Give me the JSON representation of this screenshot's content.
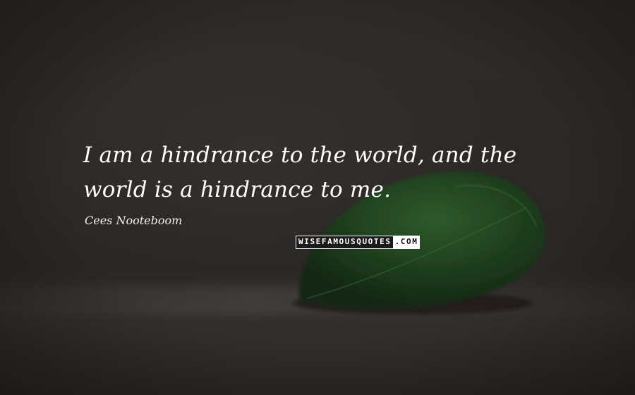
{
  "quote": {
    "text": "I am a hindrance to the world, and the world is a hindrance to me.",
    "author": "Cees Nooteboom"
  },
  "watermark": {
    "part_a": "WISEFAMOUSQUOTES",
    "part_b": ".COM"
  },
  "colors": {
    "background": "#2a2725",
    "text": "#ffffff",
    "leaf": "#1f3a1f"
  }
}
